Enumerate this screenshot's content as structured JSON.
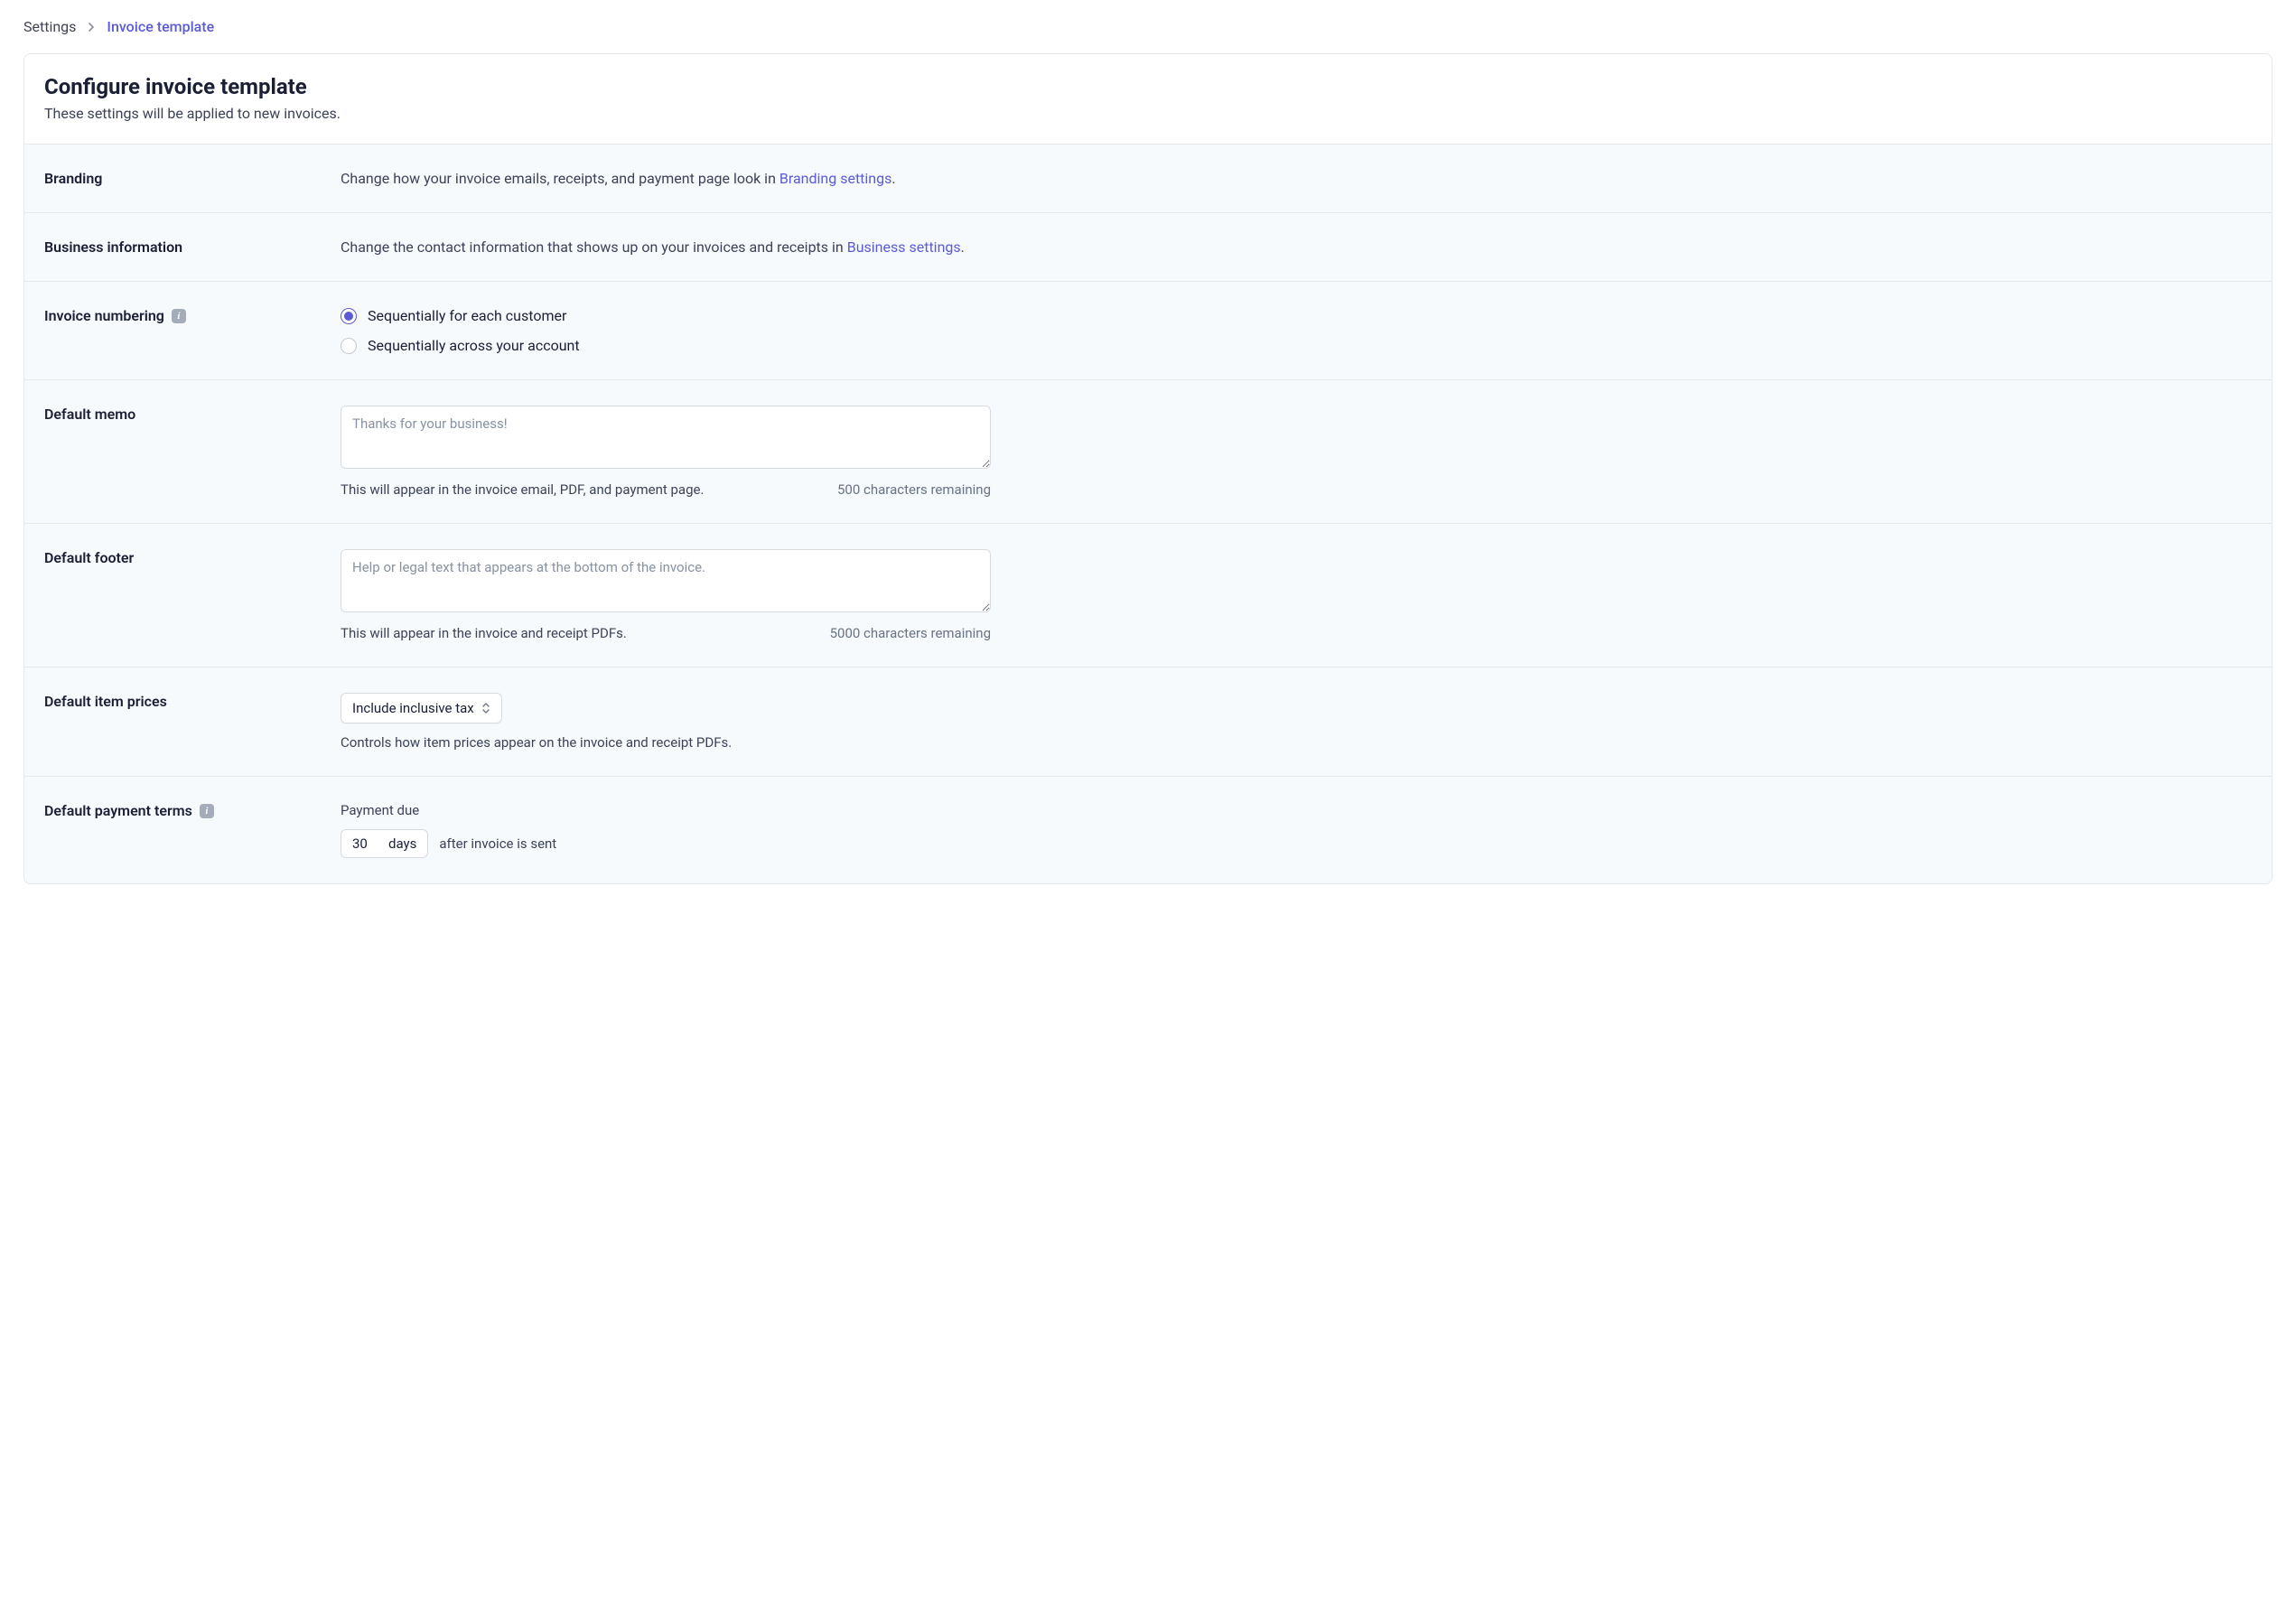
{
  "breadcrumb": {
    "root": "Settings",
    "current": "Invoice template"
  },
  "header": {
    "title": "Configure invoice template",
    "subtitle": "These settings will be applied to new invoices."
  },
  "branding": {
    "label": "Branding",
    "text_before": "Change how your invoice emails, receipts, and payment page look in ",
    "link": "Branding settings",
    "text_after": "."
  },
  "business": {
    "label": "Business information",
    "text_before": "Change the contact information that shows up on your invoices and receipts in ",
    "link": "Business settings",
    "text_after": "."
  },
  "numbering": {
    "label": "Invoice numbering",
    "options": [
      "Sequentially for each customer",
      "Sequentially across your account"
    ],
    "selected_index": 0
  },
  "memo": {
    "label": "Default memo",
    "placeholder": "Thanks for your business!",
    "value": "",
    "help": "This will appear in the invoice email, PDF, and payment page.",
    "counter": "500 characters remaining"
  },
  "footer": {
    "label": "Default footer",
    "placeholder": "Help or legal text that appears at the bottom of the invoice.",
    "value": "",
    "help": "This will appear in the invoice and receipt PDFs.",
    "counter": "5000 characters remaining"
  },
  "item_prices": {
    "label": "Default item prices",
    "select_value": "Include inclusive tax",
    "help": "Controls how item prices appear on the invoice and receipt PDFs."
  },
  "payment_terms": {
    "label": "Default payment terms",
    "sublabel": "Payment due",
    "days_value": "30",
    "days_unit": "days",
    "after_text": "after invoice is sent"
  }
}
